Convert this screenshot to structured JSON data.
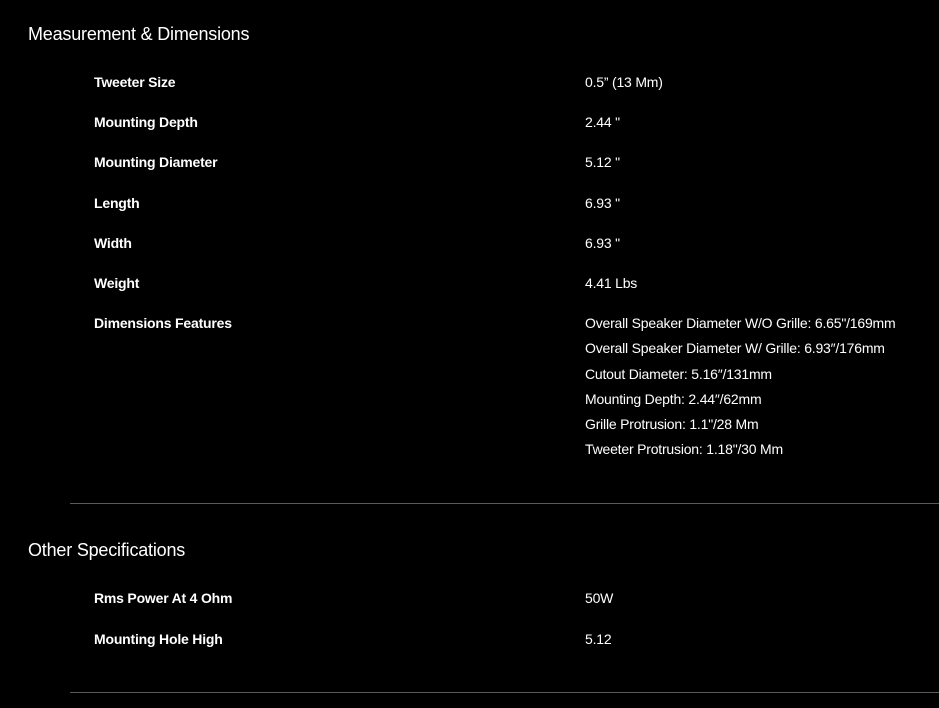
{
  "sections": [
    {
      "title": "Measurement & Dimensions",
      "rows": [
        {
          "label": "Tweeter Size",
          "value": "0.5” (13 Mm)"
        },
        {
          "label": "Mounting Depth",
          "value": "2.44 \""
        },
        {
          "label": "Mounting Diameter",
          "value": "5.12 \""
        },
        {
          "label": "Length",
          "value": "6.93 \""
        },
        {
          "label": "Width",
          "value": "6.93 \""
        },
        {
          "label": "Weight",
          "value": "4.41 Lbs"
        },
        {
          "label": "Dimensions Features",
          "values": [
            "Overall Speaker Diameter W/O Grille: 6.65\"/169mm",
            "Overall Speaker Diameter W/ Grille: 6.93″/176mm",
            "Cutout Diameter: 5.16″/131mm",
            "Mounting Depth: 2.44″/62mm",
            "Grille Protrusion: 1.1\"/28 Mm",
            "Tweeter Protrusion: 1.18\"/30 Mm"
          ]
        }
      ]
    },
    {
      "title": "Other Specifications",
      "rows": [
        {
          "label": "Rms Power At 4 Ohm",
          "value": "50W"
        },
        {
          "label": "Mounting Hole High",
          "value": "5.12"
        }
      ]
    }
  ]
}
